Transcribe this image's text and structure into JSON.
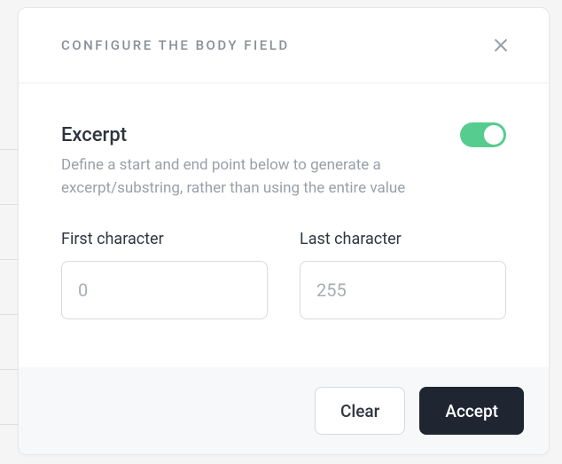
{
  "modal": {
    "title": "CONFIGURE THE BODY FIELD",
    "excerpt": {
      "heading": "Excerpt",
      "description": "Define a start and end point below to generate a excerpt/substring, rather than using the entire value",
      "enabled": true
    },
    "fields": {
      "first": {
        "label": "First character",
        "placeholder": "0",
        "value": ""
      },
      "last": {
        "label": "Last character",
        "placeholder": "255",
        "value": ""
      }
    },
    "buttons": {
      "clear": "Clear",
      "accept": "Accept"
    }
  },
  "colors": {
    "toggle_on": "#56cd8e",
    "accept_bg": "#1f2632"
  }
}
